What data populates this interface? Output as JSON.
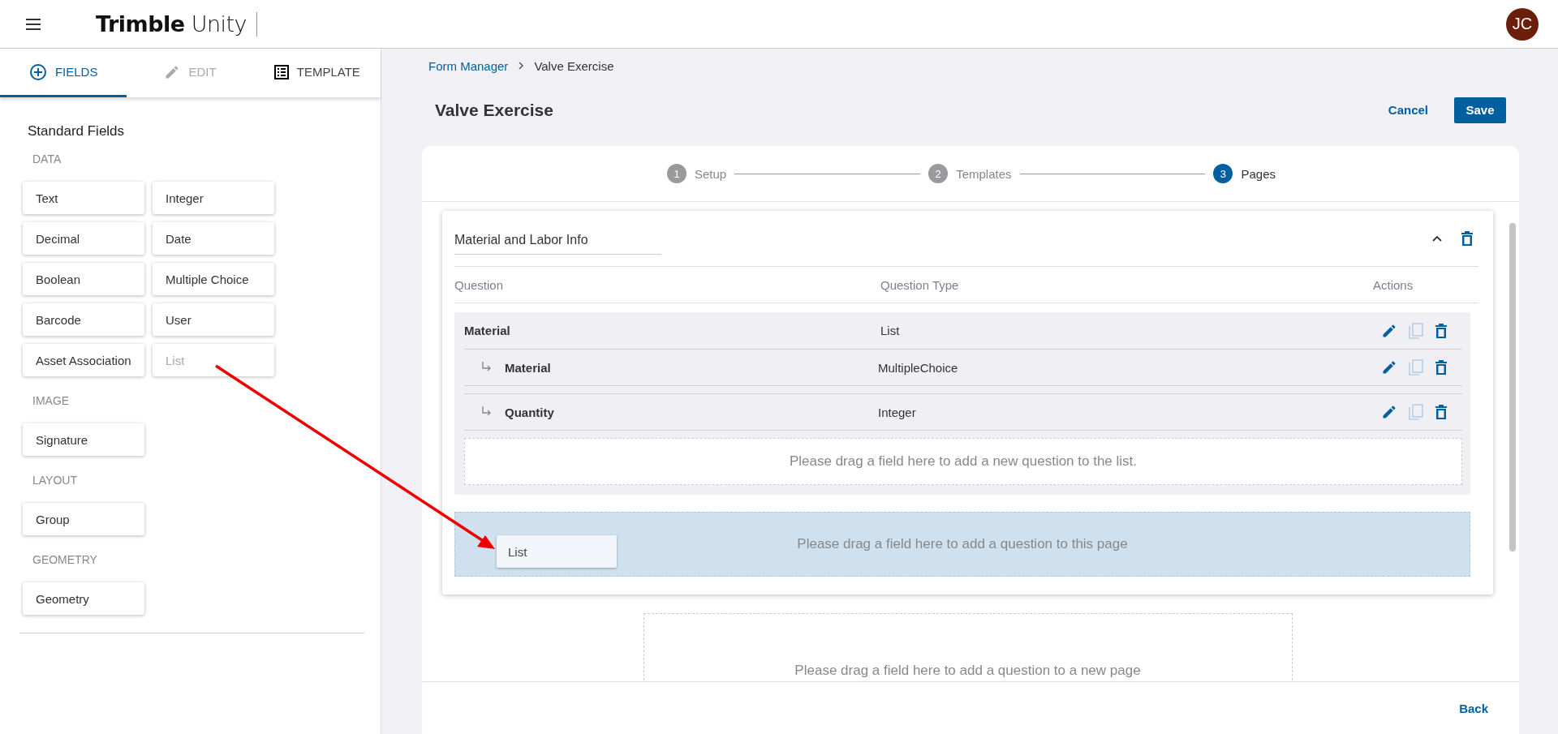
{
  "header": {
    "logo_bold": "Trimble",
    "logo_light": "Unity",
    "avatar_initials": "JC"
  },
  "sidebar": {
    "tabs": [
      {
        "label": "FIELDS",
        "kind": "add",
        "selected": true,
        "disabled": false
      },
      {
        "label": "EDIT",
        "kind": "edit",
        "selected": false,
        "disabled": true
      },
      {
        "label": "TEMPLATE",
        "kind": "template",
        "selected": false,
        "disabled": false
      }
    ],
    "title": "Standard Fields",
    "groups": [
      {
        "label": "DATA",
        "fields": [
          {
            "label": "Text",
            "dragging": false
          },
          {
            "label": "Integer",
            "dragging": false
          },
          {
            "label": "Decimal",
            "dragging": false
          },
          {
            "label": "Date",
            "dragging": false
          },
          {
            "label": "Boolean",
            "dragging": false
          },
          {
            "label": "Multiple Choice",
            "dragging": false
          },
          {
            "label": "Barcode",
            "dragging": false
          },
          {
            "label": "User",
            "dragging": false
          },
          {
            "label": "Asset Association",
            "dragging": false
          },
          {
            "label": "List",
            "dragging": true
          }
        ]
      },
      {
        "label": "IMAGE",
        "fields": [
          {
            "label": "Signature",
            "dragging": false
          }
        ]
      },
      {
        "label": "LAYOUT",
        "fields": [
          {
            "label": "Group",
            "dragging": false
          }
        ]
      },
      {
        "label": "GEOMETRY",
        "fields": [
          {
            "label": "Geometry",
            "dragging": false
          }
        ]
      }
    ]
  },
  "breadcrumb": [
    {
      "label": "Form Manager",
      "kind": "link"
    },
    {
      "label": "Valve Exercise",
      "kind": "current"
    }
  ],
  "page_title": "Valve Exercise",
  "buttons": {
    "cancel": "Cancel",
    "save": "Save"
  },
  "steps": [
    {
      "number": "1",
      "label": "Setup",
      "selected": false
    },
    {
      "number": "2",
      "label": "Templates",
      "selected": false
    },
    {
      "number": "3",
      "label": "Pages",
      "selected": true
    }
  ],
  "page": {
    "name": "Material and Labor Info",
    "expanded": true,
    "columns": [
      "Question",
      "Question Type",
      "Actions"
    ],
    "questions": [
      {
        "question": "Material",
        "type": "List",
        "actions": [
          {
            "kind": "edit",
            "disabled": false
          },
          {
            "kind": "copy",
            "disabled": true
          },
          {
            "kind": "delete",
            "disabled": false
          }
        ],
        "children": [
          {
            "question": "Material",
            "type": "MultipleChoice",
            "actions": [
              {
                "kind": "edit",
                "disabled": false
              },
              {
                "kind": "copy",
                "disabled": true
              },
              {
                "kind": "delete",
                "disabled": false
              }
            ]
          },
          {
            "question": "Quantity",
            "type": "Integer",
            "actions": [
              {
                "kind": "edit",
                "disabled": false
              },
              {
                "kind": "copy",
                "disabled": true
              },
              {
                "kind": "delete",
                "disabled": false
              }
            ]
          }
        ],
        "list_drop_hint": "Please drag a field here to add a new question to the list."
      }
    ],
    "drop_hint": "Please drag a field here to add a question to this page",
    "drag_ghost": "List"
  },
  "new_page_hint": "Please drag a field here to add a question to a new page",
  "footer": {
    "back": "Back"
  }
}
